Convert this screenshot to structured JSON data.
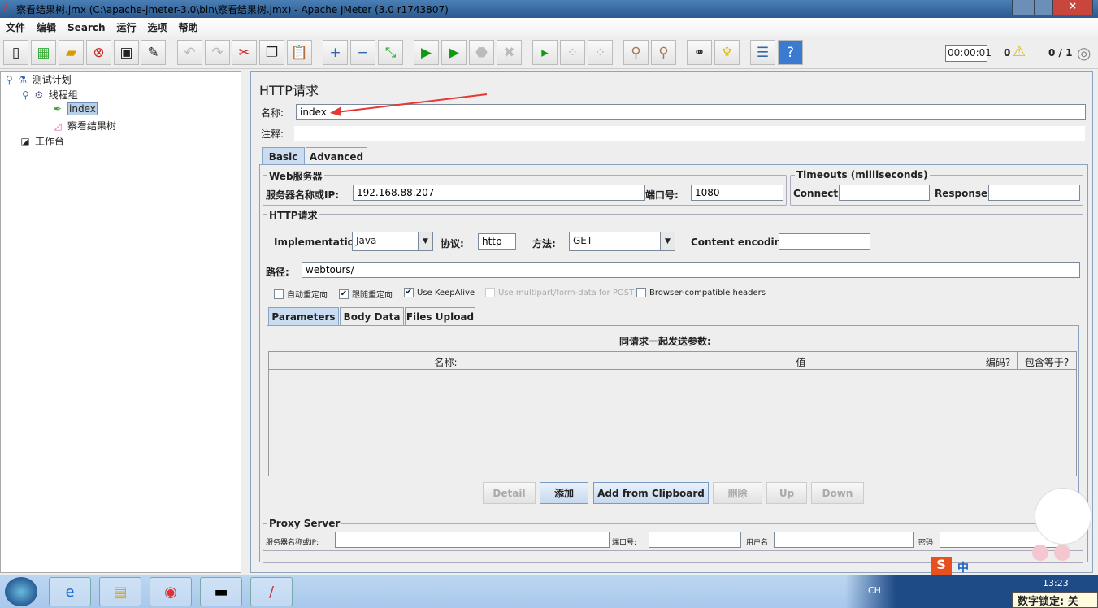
{
  "window": {
    "title": "察看结果树.jmx (C:\\apache-jmeter-3.0\\bin\\察看结果树.jmx) - Apache JMeter (3.0 r1743807)"
  },
  "menu": [
    "文件",
    "编辑",
    "Search",
    "运行",
    "选项",
    "帮助"
  ],
  "toolbar": {
    "icons": [
      "new-icon",
      "templates-icon",
      "open-icon",
      "close-icon",
      "save-icon",
      "save-as-icon",
      "undo-icon",
      "redo-icon",
      "cut-icon",
      "copy-icon",
      "paste-icon",
      "expand-icon",
      "collapse-icon",
      "toggle-icon",
      "start-icon",
      "start-no-pause-icon",
      "stop-icon",
      "shutdown-icon",
      "remote-start-icon",
      "remote-stop-icon",
      "remote-shutdown-icon",
      "clear-icon",
      "clear-all-icon",
      "search-icon",
      "reset-search-icon",
      "function-helper-icon",
      "help-icon"
    ],
    "timer": "00:00:01",
    "warnings": "0",
    "threads": "0 / 1"
  },
  "tree": {
    "items": [
      {
        "label": "测试计划"
      },
      {
        "label": "线程组"
      },
      {
        "label": "index",
        "selected": true
      },
      {
        "label": "察看结果树"
      },
      {
        "label": "工作台"
      }
    ]
  },
  "panel": {
    "title": "HTTP请求",
    "name_label": "名称:",
    "name_value": "index",
    "comment_label": "注释:",
    "comment_value": "",
    "tabs": [
      "Basic",
      "Advanced"
    ],
    "web_server": {
      "title": "Web服务器",
      "server_label": "服务器名称或IP:",
      "server_value": "192.168.88.207",
      "port_label": "端口号:",
      "port_value": "1080"
    },
    "timeouts": {
      "title": "Timeouts (milliseconds)",
      "connect_label": "Connect:",
      "connect_value": "",
      "response_label": "Response:",
      "response_value": ""
    },
    "http": {
      "title": "HTTP请求",
      "impl_label": "Implementation:",
      "impl_value": "Java",
      "protocol_label": "协议:",
      "protocol_value": "http",
      "method_label": "方法:",
      "method_value": "GET",
      "encoding_label": "Content encoding:",
      "encoding_value": "",
      "path_label": "路径:",
      "path_value": "webtours/"
    },
    "checkboxes": [
      {
        "label": "自动重定向",
        "checked": false
      },
      {
        "label": "跟随重定向",
        "checked": true
      },
      {
        "label": "Use KeepAlive",
        "checked": true
      },
      {
        "label": "Use multipart/form-data for POST",
        "checked": false,
        "disabled": true
      },
      {
        "label": "Browser-compatible headers",
        "checked": false
      }
    ],
    "subtabs": [
      "Parameters",
      "Body Data",
      "Files Upload"
    ],
    "params": {
      "title": "同请求一起发送参数:",
      "columns": [
        "名称:",
        "值",
        "编码?",
        "包含等于?"
      ],
      "rows": []
    },
    "buttons": [
      {
        "label": "Detail",
        "disabled": true
      },
      {
        "label": "添加"
      },
      {
        "label": "Add from Clipboard"
      },
      {
        "label": "删除",
        "disabled": true
      },
      {
        "label": "Up",
        "disabled": true
      },
      {
        "label": "Down",
        "disabled": true
      }
    ],
    "proxy": {
      "title": "Proxy Server",
      "server_label": "服务器名称或IP:",
      "port_label": "端口号:",
      "user_label": "用户名",
      "pass_label": "密码"
    }
  },
  "taskbar": {
    "lang": "CH",
    "time": "13:23",
    "numlock": "数字锁定: 关",
    "ime": "中"
  },
  "colors": {
    "accent": "#c9dcf0",
    "arrow": "#e53935"
  }
}
